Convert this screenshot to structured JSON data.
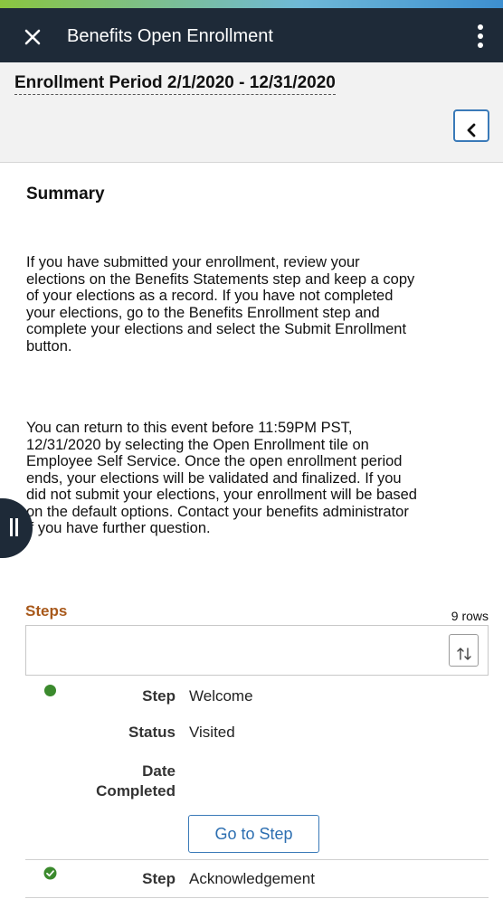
{
  "window": {
    "title": "Benefits Open Enrollment"
  },
  "period": {
    "title": "Enrollment Period 2/1/2020 - 12/31/2020"
  },
  "summary": {
    "heading": "Summary",
    "paragraphs": [
      [
        "If you have submitted your enrollment, review your",
        "elections on the Benefits Statements step and keep a copy",
        "of your elections as a record. If you have not completed",
        "your elections, go to the Benefits Enrollment step and",
        "complete your elections and select the Submit Enrollment",
        "button."
      ],
      [
        "You can return to this event before 11:59PM PST,",
        "12/31/2020 by selecting the Open Enrollment tile on",
        "Employee Self Service. Once the open enrollment period",
        "ends, your elections will be validated and finalized. If you",
        "did not submit your elections, your enrollment will be based",
        "on the default options.  Contact your benefits administrator",
        "if you have further question."
      ]
    ]
  },
  "steps": {
    "heading": "Steps",
    "row_count": "9 rows",
    "labels": {
      "step": "Step",
      "status": "Status",
      "date_completed_line1": "Date",
      "date_completed_line2": "Completed"
    },
    "rows": [
      {
        "step": "Welcome",
        "status": "Visited",
        "date_completed": "",
        "button": "Go to Step",
        "status_icon": "green-dot-icon",
        "status_color": "#3b8a2d"
      },
      {
        "step": "Acknowledgement",
        "status_icon": "green-check-icon",
        "status_color": "#3b8a2d"
      }
    ]
  }
}
